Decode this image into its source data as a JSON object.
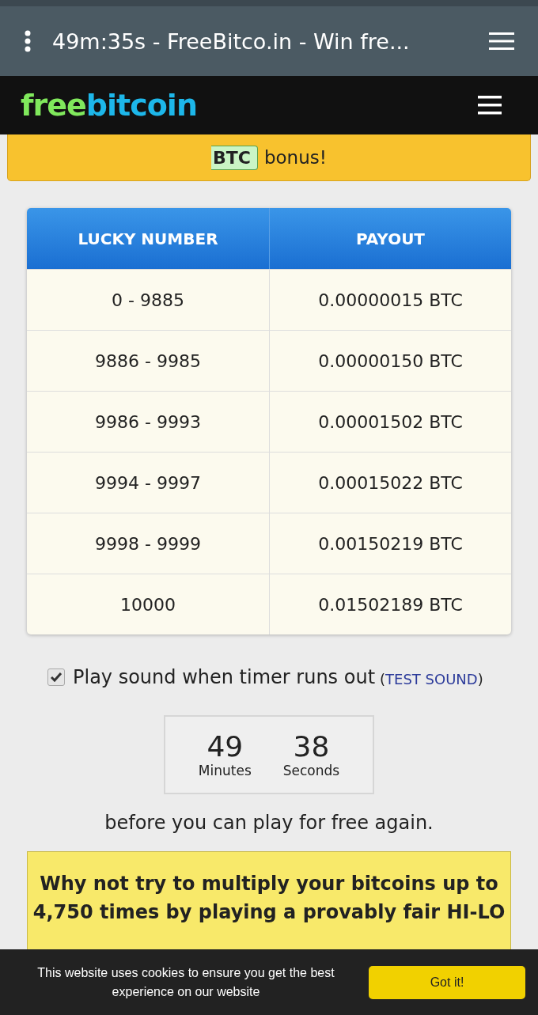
{
  "browser": {
    "title": "49m:35s - FreeBitco.in - Win fre..."
  },
  "site_header": {
    "logo": [
      {
        "text": "free",
        "color": "#80e85c"
      },
      {
        "text": "bitcoin",
        "color": "#1db7ea"
      }
    ]
  },
  "bonus_banner": {
    "badge": "BTC",
    "text": "bonus!"
  },
  "payout_table": {
    "columns": [
      "LUCKY NUMBER",
      "PAYOUT"
    ],
    "rows": [
      [
        "0 - 9885",
        "0.00000015 BTC"
      ],
      [
        "9886 - 9985",
        "0.00000150 BTC"
      ],
      [
        "9986 - 9993",
        "0.00001502 BTC"
      ],
      [
        "9994 - 9997",
        "0.00015022 BTC"
      ],
      [
        "9998 - 9999",
        "0.00150219 BTC"
      ],
      [
        "10000",
        "0.01502189 BTC"
      ]
    ]
  },
  "sound_option": {
    "label": "Play sound when timer runs out",
    "checked": true,
    "link_open": "(",
    "link": "TEST SOUND",
    "link_close": ")"
  },
  "timer": {
    "units": [
      {
        "value": "49",
        "label": "Minutes"
      },
      {
        "value": "38",
        "label": "Seconds"
      }
    ]
  },
  "wait_text": "before you can play for free again.",
  "promo": {
    "lines": [
      "Why not try to multiply your bitcoins up to",
      "4,750 times by playing a provably fair HI-LO"
    ]
  },
  "cookie_bar": {
    "text": "This website uses cookies to ensure you get the best experience on our website",
    "button": "Got it!"
  }
}
